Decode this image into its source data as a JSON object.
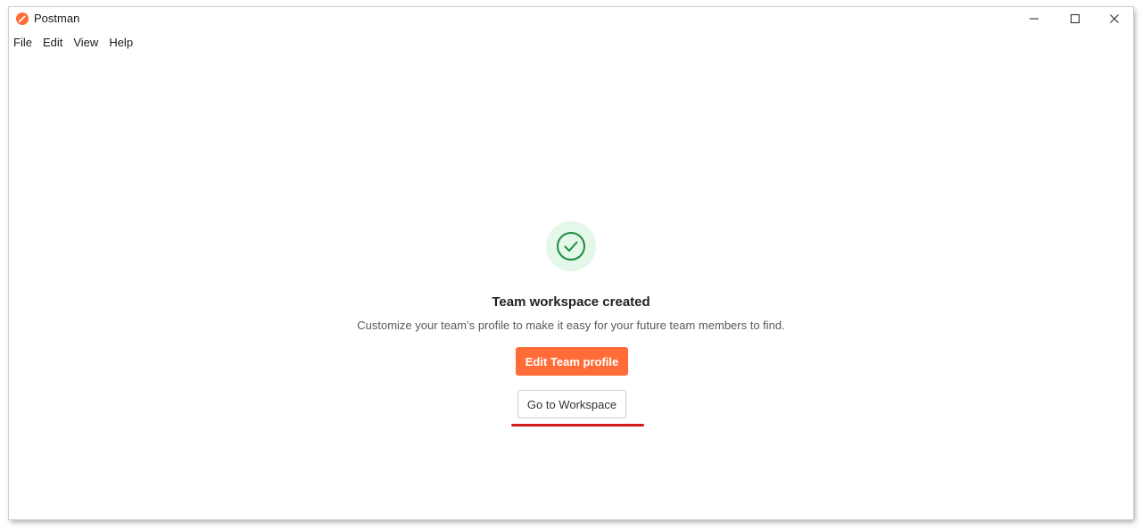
{
  "window": {
    "title": "Postman",
    "logo_icon": "postman-logo-icon",
    "controls": [
      "minimize-icon",
      "maximize-icon",
      "close-icon"
    ]
  },
  "menu": {
    "items": [
      "File",
      "Edit",
      "View",
      "Help"
    ]
  },
  "main": {
    "status_icon": "check-circle-icon",
    "headline": "Team workspace created",
    "subtext": "Customize your team’s profile to make it easy for your future team members to find.",
    "primary_button": "Edit Team profile",
    "secondary_button": "Go to Workspace"
  },
  "colors": {
    "brand": "#ff6c37",
    "success": "#1f8a45",
    "success_bg": "#e3f8e8",
    "annotation": "#d01c1c"
  }
}
